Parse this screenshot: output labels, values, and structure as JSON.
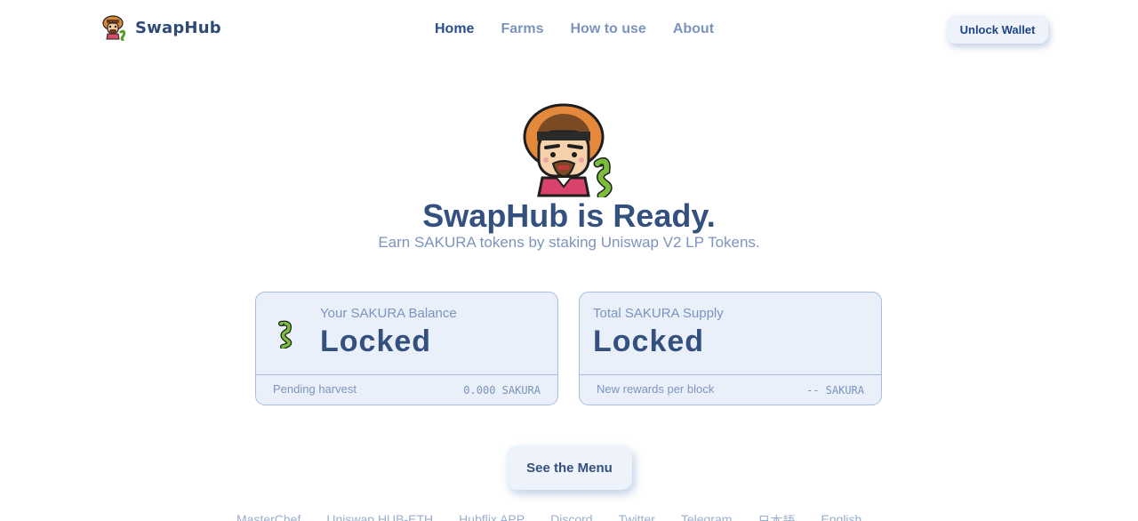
{
  "header": {
    "brand_name": "SwapHub",
    "nav": [
      {
        "label": "Home",
        "active": true
      },
      {
        "label": "Farms",
        "active": false
      },
      {
        "label": "How to use",
        "active": false
      },
      {
        "label": "About",
        "active": false
      }
    ],
    "unlock_wallet_label": "Unlock Wallet"
  },
  "hero": {
    "title": "SwapHub is Ready.",
    "subtitle": "Earn SAKURA tokens by staking Uniswap V2 LP Tokens."
  },
  "cards": {
    "balance": {
      "label": "Your SAKURA Balance",
      "value": "Locked",
      "footer_label": "Pending harvest",
      "footer_value": "0.000 SAKURA"
    },
    "supply": {
      "label": "Total SAKURA Supply",
      "value": "Locked",
      "footer_label": "New rewards per block",
      "footer_value": "-- SAKURA"
    }
  },
  "menu_button_label": "See the Menu",
  "footer_links": [
    "MasterChef",
    "Uniswap HUB-ETH",
    "Hubflix APP",
    "Discord",
    "Twitter",
    "Telegram",
    "日本語",
    "English"
  ],
  "colors": {
    "primary_text": "#34507e",
    "muted_text": "#7b94bd",
    "card_bg": "#eaf0fa",
    "card_border": "#a8bde0"
  }
}
